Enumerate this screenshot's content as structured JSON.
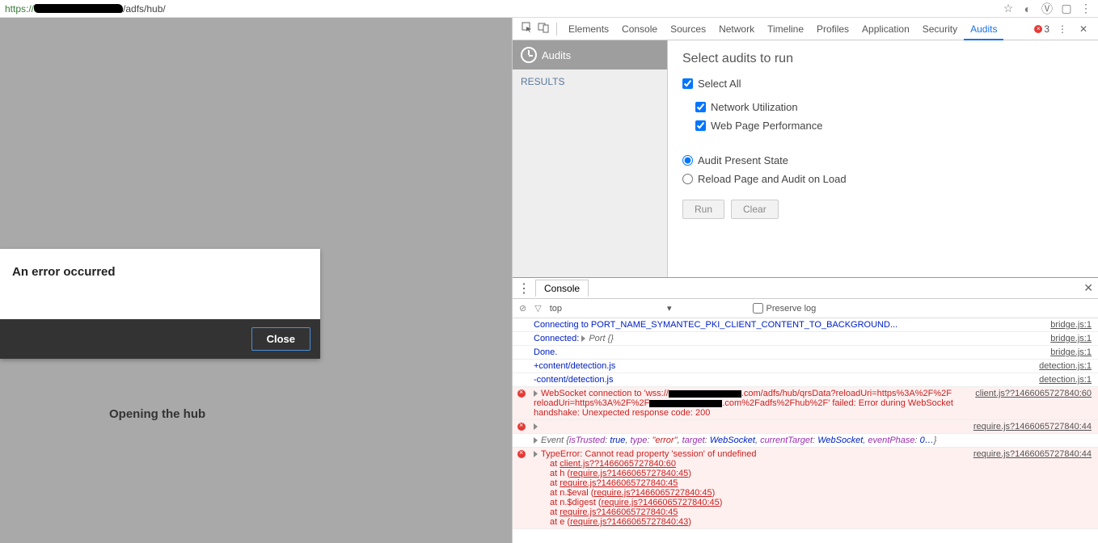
{
  "url": {
    "scheme": "https://",
    "path": "/adfs/hub/"
  },
  "page": {
    "status": "Opening the hub",
    "modal_title": "An error occurred",
    "close": "Close"
  },
  "toolbar": {
    "tabs": [
      "Elements",
      "Console",
      "Sources",
      "Network",
      "Timeline",
      "Profiles",
      "Application",
      "Security",
      "Audits"
    ],
    "active": "Audits",
    "error_count": "3"
  },
  "audits": {
    "label": "Audits",
    "results": "RESULTS",
    "title": "Select audits to run",
    "select_all": "Select All",
    "checks": [
      "Network Utilization",
      "Web Page Performance"
    ],
    "radios": [
      "Audit Present State",
      "Reload Page and Audit on Load"
    ],
    "run": "Run",
    "clear": "Clear"
  },
  "drawer": {
    "tab": "Console",
    "context": "top",
    "preserve": "Preserve log"
  },
  "logs": {
    "l0": {
      "msg": "Connecting to PORT_NAME_SYMANTEC_PKI_CLIENT_CONTENT_TO_BACKGROUND...",
      "src": "bridge.js:1"
    },
    "l1": {
      "a": "Connected: ",
      "b": "Port {}",
      "src": "bridge.js:1"
    },
    "l2": {
      "msg": "Done.",
      "src": "bridge.js:1"
    },
    "l3": {
      "msg": "+content/detection.js",
      "src": "detection.js:1"
    },
    "l4": {
      "msg": "-content/detection.js",
      "src": "detection.js:1"
    },
    "l5": {
      "a": "WebSocket connection to '",
      "b": "wss://",
      "c": ".com/adfs/hub/qrsData?reloadUri=https%3A%2F%2F",
      "d": ".com%2Fadfs%2Fhub%2F' failed: Error during WebSocket handshake: Unexpected response code: 200",
      "src": "client.js??1466065727840:60"
    },
    "l6": {
      "src": "require.js?1466065727840:44"
    },
    "l6b": {
      "ev": "Event ",
      "p1": "isTrusted",
      "v1": "true",
      "p2": "type",
      "v2": "\"error\"",
      "p3": "target",
      "v3": "WebSocket",
      "p4": "currentTarget",
      "v4": "WebSocket",
      "p5": "eventPhase",
      "v5": "0…"
    },
    "l7": {
      "msg": "TypeError: Cannot read property 'session' of undefined",
      "src": "require.js?1466065727840:44",
      "s0": "at ",
      "f0": "client.js??1466065727840:60",
      "s1": "at h (",
      "f1": "require.js?1466065727840:45",
      "e1": ")",
      "s2": "at ",
      "f2": "require.js?1466065727840:45",
      "s3": "at n.$eval (",
      "f3": "require.js?1466065727840:45",
      "e3": ")",
      "s4": "at n.$digest (",
      "f4": "require.js?1466065727840:45",
      "e4": ")",
      "s5": "at ",
      "f5": "require.js?1466065727840:45",
      "s6": "at e (",
      "f6": "require.js?1466065727840:43",
      "e6": ")"
    }
  }
}
